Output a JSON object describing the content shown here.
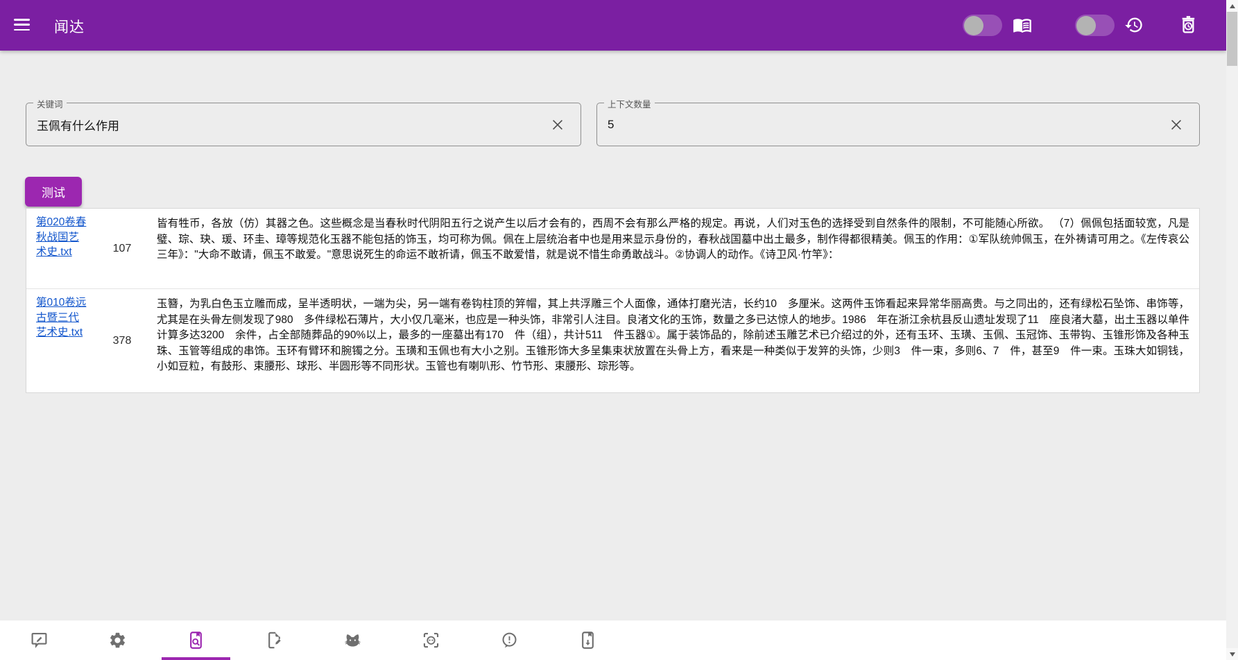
{
  "app": {
    "title": "闻达",
    "colors": {
      "header": "#7b1fa2",
      "accent": "#9c27b0",
      "link": "#1155cc",
      "page_bg": "#ededed"
    }
  },
  "header": {
    "menu_icon": "hamburger-icon",
    "toggle_1": {
      "state": "off"
    },
    "toggle_2": {
      "state": "off"
    },
    "icons": [
      "menu-book-icon",
      "history-icon",
      "auto-delete-icon"
    ]
  },
  "form": {
    "keyword": {
      "label": "关键词",
      "value": "玉佩有什么作用",
      "clear_icon": "close-icon"
    },
    "context_count": {
      "label": "上下文数量",
      "value": "5",
      "clear_icon": "close-icon"
    }
  },
  "actions": {
    "test_label": "测试"
  },
  "results": {
    "rows": [
      {
        "file": "第020卷春秋战国艺术史.txt",
        "count": "107",
        "text": "皆有牲币，各放（仿）其器之色。这些概念是当春秋时代阴阳五行之说产生以后才会有的，西周不会有那么严格的规定。再说，人们对玉色的选择受到自然条件的限制，不可能随心所欲。 （7）佩佩包括面较宽，凡是璧、琮、玦、瑗、环圭、璋等规范化玉器不能包括的饰玉，均可称为佩。佩在上层统治者中也是用来显示身份的，春秋战国墓中出土最多，制作得都很精美。佩玉的作用：①军队统帅佩玉，在外祷请可用之。《左传哀公三年》：\"大命不敢请，佩玉不敢爱。\"意思说死生的命运不敢祈请，佩玉不敢爱惜，就是说不惜生命勇敢战斗。②协调人的动作。《诗卫风·竹竿》："
      },
      {
        "file": "第010卷远古暨三代艺术史.txt",
        "count": "378",
        "text": "玉簪，为乳白色玉立雕而成，呈半透明状，一端为尖，另一端有卷钩柱顶的笄帽，其上共浮雕三个人面像，通体打磨光洁，长约10　多厘米。这两件玉饰看起来异常华丽高贵。与之同出的，还有绿松石坠饰、串饰等，尤其是在头骨左侧发现了980　多件绿松石薄片，大小仅几毫米，也应是一种头饰，非常引人注目。良渚文化的玉饰，数量之多已达惊人的地步。1986　年在浙江余杭县反山遗址发现了11　座良渚大墓，出土玉器以单件计算多达3200　余件，占全部随葬品的90%以上，最多的一座墓出有170　件（组），共计511　件玉器①。属于装饰品的，除前述玉雕艺术已介绍过的外，还有玉环、玉璜、玉佩、玉冠饰、玉带钩、玉锥形饰及各种玉珠、玉管等组成的串饰。玉环有臂环和腕镯之分。玉璜和玉佩也有大小之别。玉锥形饰大多呈集束状放置在头骨上方，看来是一种类似于发笄的头饰，少则3　件一束，多则6、7　件，甚至9　件一束。玉珠大如铜钱，小如豆粒，有鼓形、束腰形、球形、半圆形等不同形状。玉管也有喇叭形、竹节形、束腰形、琮形等。"
      }
    ]
  },
  "bottom_nav": {
    "active_index": 2,
    "items": [
      "feedback-draft-icon",
      "settings-gear-icon",
      "knowledge-search-icon",
      "document-edit-icon",
      "cat-icon",
      "face-recognition-icon",
      "message-alert-icon",
      "knowledge-download-icon"
    ]
  }
}
